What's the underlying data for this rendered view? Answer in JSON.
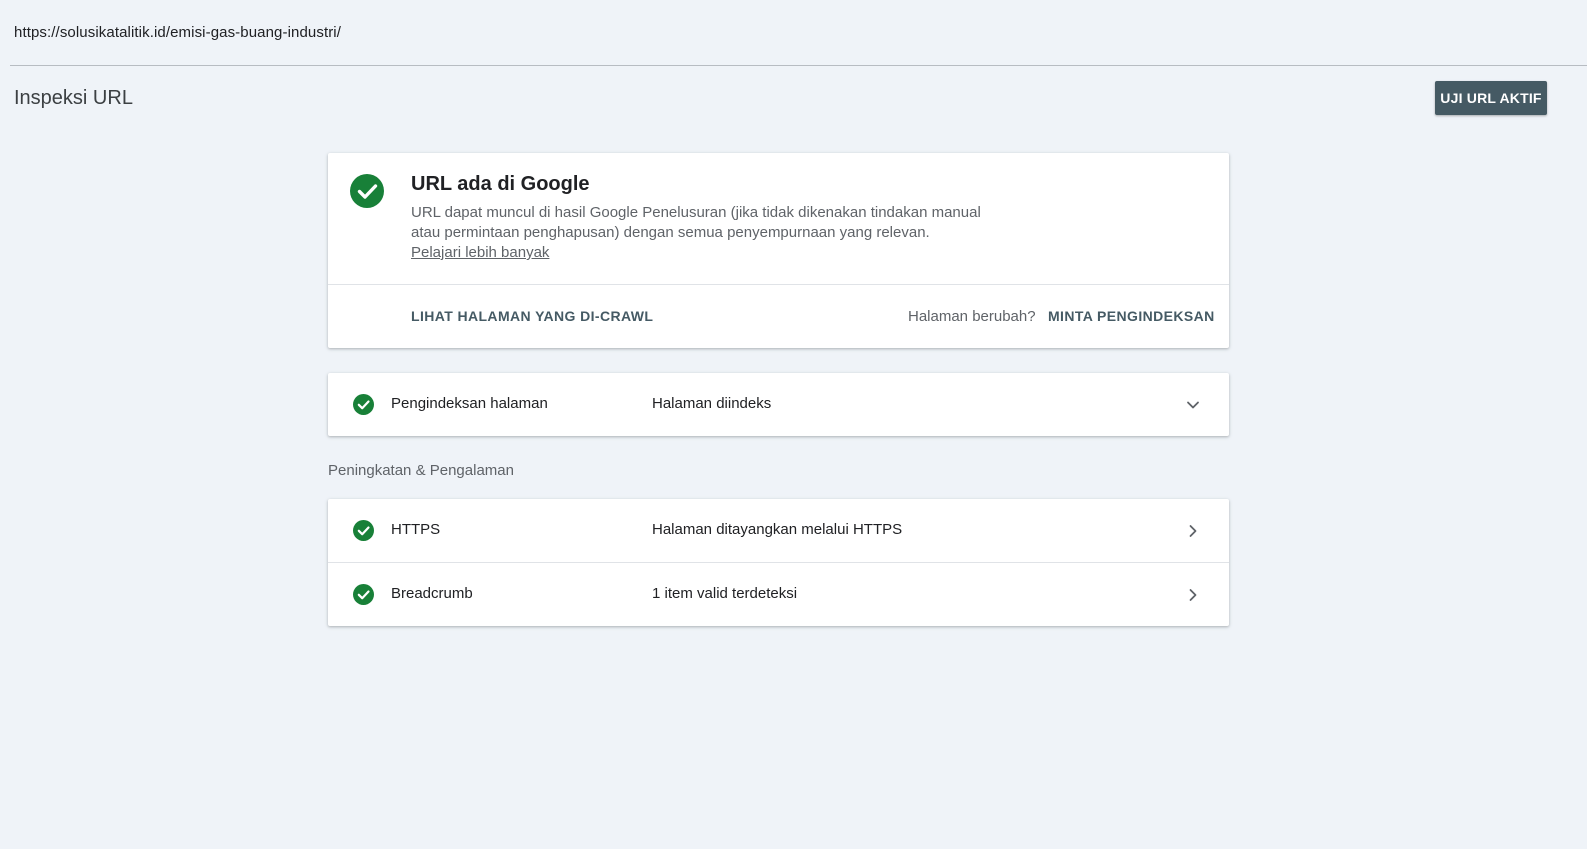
{
  "inspected_url": "https://solusikatalitik.id/emisi-gas-buang-industri/",
  "page_title": "Inspeksi URL",
  "live_test_button": "UJI URL AKTIF",
  "status": {
    "title": "URL ada di Google",
    "description_line1": "URL dapat muncul di hasil Google Penelusuran (jika tidak dikenakan tindakan manual",
    "description_line2": "atau permintaan penghapusan) dengan semua penyempurnaan yang relevan.",
    "learn_more": "Pelajari lebih banyak",
    "view_crawled": "LIHAT HALAMAN YANG DI-CRAWL",
    "page_changed": "Halaman berubah?",
    "request_indexing": "MINTA PENGINDEKSAN",
    "icon": "check-circle-icon",
    "status_color": "#188038"
  },
  "indexing": {
    "label": "Pengindeksan halaman",
    "value": "Halaman diindeks",
    "icon": "chevron-down-icon"
  },
  "enhancements": {
    "heading": "Peningkatan & Pengalaman",
    "rows": [
      {
        "label": "HTTPS",
        "value": "Halaman ditayangkan melalui HTTPS",
        "icon": "chevron-right-icon"
      },
      {
        "label": "Breadcrumb",
        "value": "1 item valid terdeteksi",
        "icon": "chevron-right-icon"
      }
    ]
  },
  "colors": {
    "background": "#eff3f8",
    "accent": "#455a64",
    "success": "#188038"
  }
}
